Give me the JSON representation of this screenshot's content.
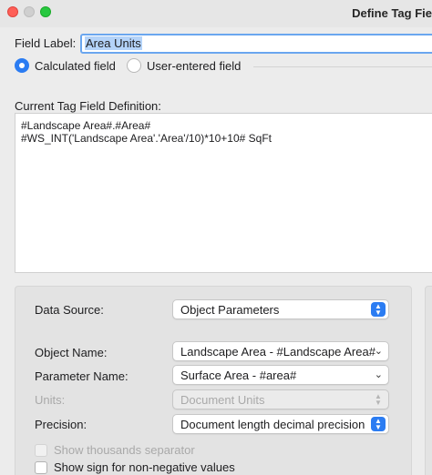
{
  "window": {
    "title": "Define Tag Fie"
  },
  "field_label": {
    "label": "Field Label:",
    "value": "Area Units"
  },
  "mode": {
    "calculated_label": "Calculated field",
    "user_entered_label": "User-entered field",
    "selected": "calculated"
  },
  "definition": {
    "label": "Current Tag Field Definition:",
    "lines": [
      "#Landscape Area#.#Area#",
      "#WS_INT('Landscape Area'.'Area'/10)*10+10# SqFt"
    ]
  },
  "params": {
    "data_source_label": "Data Source:",
    "data_source_value": "Object Parameters",
    "object_name_label": "Object Name:",
    "object_name_value": "Landscape Area - #Landscape Area#",
    "parameter_name_label": "Parameter Name:",
    "parameter_name_value": "Surface Area - #area#",
    "units_label": "Units:",
    "units_value": "Document Units",
    "precision_label": "Precision:",
    "precision_value": "Document length decimal precision",
    "show_thousands_label": "Show thousands separator",
    "show_sign_label": "Show sign for non-negative values"
  },
  "colors": {
    "accent": "#2b7cf2",
    "selection": "#b4d3f9"
  }
}
